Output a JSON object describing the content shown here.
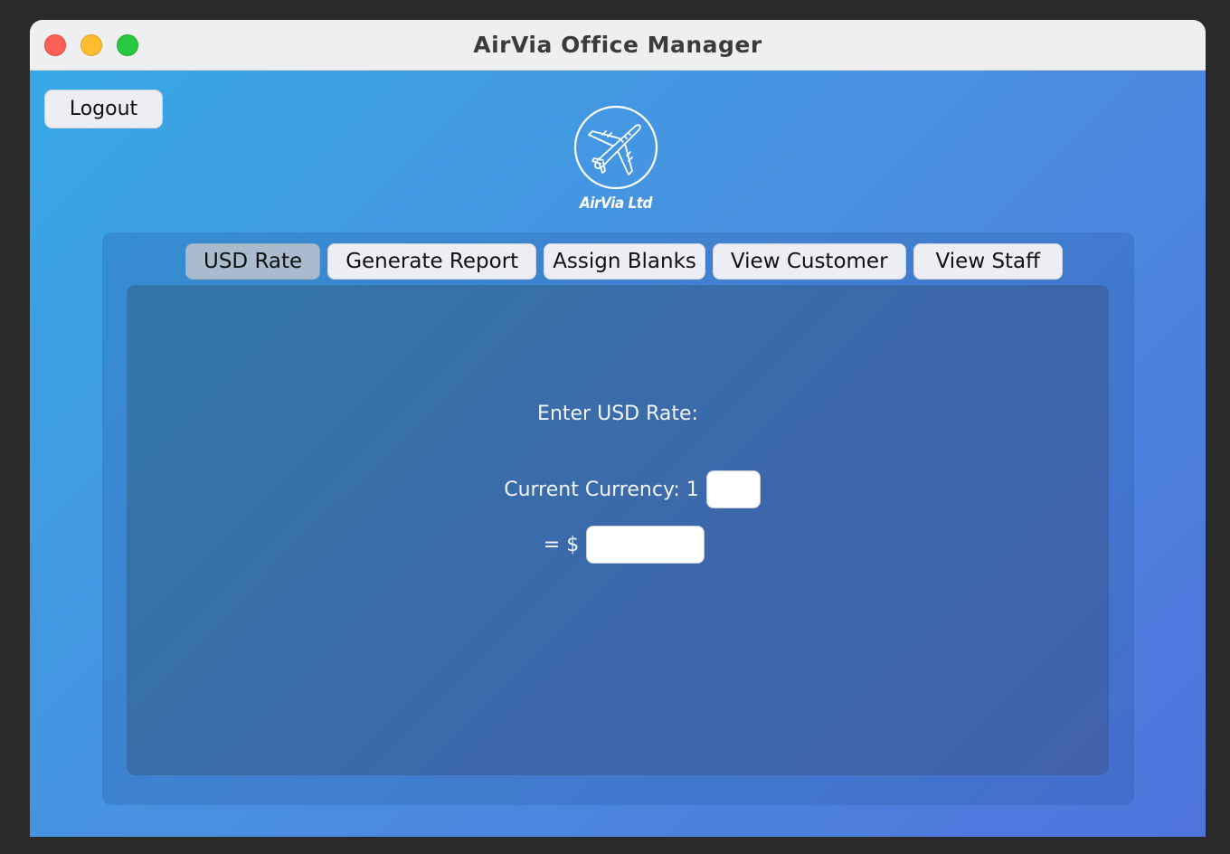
{
  "window": {
    "title": "AirVia Office Manager"
  },
  "header": {
    "logout_label": "Logout",
    "logo_text": "AirVia Ltd",
    "logo_icon": "airplane-icon"
  },
  "tabs": [
    {
      "label": "USD Rate",
      "selected": true
    },
    {
      "label": "Generate Report",
      "selected": false
    },
    {
      "label": "Assign Blanks",
      "selected": false
    },
    {
      "label": "View Customer",
      "selected": false
    },
    {
      "label": "View Staff",
      "selected": false
    }
  ],
  "usd_rate": {
    "prompt": "Enter USD Rate:",
    "currency_label": "Current Currency: 1",
    "currency_value": "",
    "dollar_label": "= $",
    "dollar_value": ""
  },
  "colors": {
    "close": "#fe5f57",
    "minimize": "#febc2e",
    "maximize": "#28c840"
  }
}
